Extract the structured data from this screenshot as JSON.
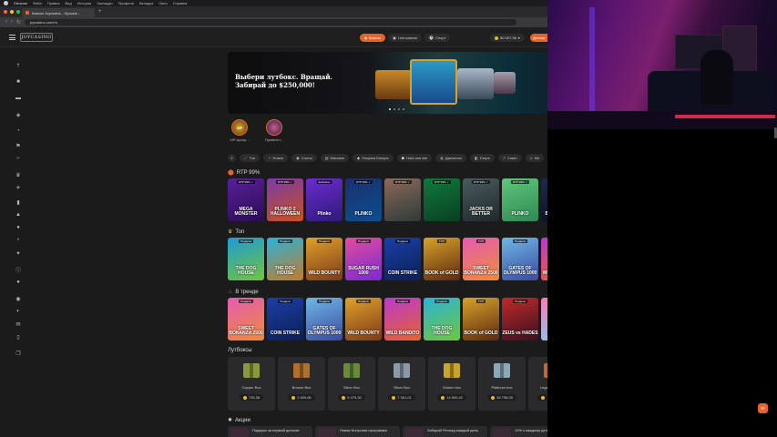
{
  "mac": {
    "app": "Chrome",
    "menus": [
      "Файл",
      "Правка",
      "Вид",
      "История",
      "Закладки",
      "Профили",
      "Вкладка",
      "Окно",
      "Справка"
    ]
  },
  "browser": {
    "tab_title": "Казино Joycasino - Лучшие...",
    "url": "joycasino.com/ru"
  },
  "header": {
    "logo": "JOYCASINO",
    "nav": [
      {
        "label": "Казино",
        "icon": "casino-icon",
        "active": true
      },
      {
        "label": "Live-казино",
        "icon": "live-icon",
        "active": false
      },
      {
        "label": "Спорт",
        "icon": "sport-icon",
        "active": false
      }
    ],
    "balance": "50 007,96",
    "deposit_label": "Депози"
  },
  "banner": {
    "text": "Выбери лутбокс. Вращай.\nЗабирай до $250,000!"
  },
  "stories": [
    {
      "badge": "VIP",
      "label": "VIP-прогр..."
    },
    {
      "badge": "",
      "label": "Приветст..."
    }
  ],
  "filters": [
    "Топ",
    "Новое",
    "Слоты",
    "Магазин",
    "Покупка Бонуса",
    "Hold and win",
    "Джекпоты",
    "Drops",
    "Crash",
    "Ме"
  ],
  "sections": {
    "rtp": "RTP 99%",
    "top": "Топ",
    "trending": "В тренде",
    "lootboxes": "Лутбоксы",
    "promotions": "Акции"
  },
  "rtp_games": [
    {
      "name": "MEGA MONSTER",
      "badge": "RTP 99% ✓",
      "color": "#5a1f9a",
      "color2": "#2a0d55"
    },
    {
      "name": "PLINKO 2 HALLOWEEN",
      "badge": "RTP 99% ✓",
      "color": "#7b3aa8",
      "color2": "#c8521e"
    },
    {
      "name": "Plinko",
      "badge": "Exclusive",
      "color": "#6b2ccf",
      "color2": "#2d1a7a"
    },
    {
      "name": "PLINKO",
      "badge": "RTP 99% ✓",
      "color": "#1a2f6e",
      "color2": "#0c4f8e"
    },
    {
      "name": "",
      "badge": "RTP 99% ✓",
      "color": "#8c6a58",
      "color2": "#2e3a3a"
    },
    {
      "name": "",
      "badge": "RTP 99% ✓",
      "color": "#0f7a3c",
      "color2": "#0a3f22"
    },
    {
      "name": "JACKS OR BETTER",
      "badge": "RTP 99% ✓",
      "color": "#4a5a5e",
      "color2": "#1f2a2d"
    },
    {
      "name": "PLINKO",
      "badge": "RTP 99% ✓",
      "color": "#5ec77a",
      "color2": "#2f8a55"
    },
    {
      "name": "BLACKJACK",
      "badge": "RTP 99% ✓",
      "color": "#1c2a4a",
      "color2": "#0a0f22"
    }
  ],
  "top_games": [
    {
      "name": "THE DOG HOUSE",
      "badge": "Подарок",
      "color": "#1f9ad6",
      "color2": "#6fc63b"
    },
    {
      "name": "THE DOG HOUSE",
      "badge": "Подарок",
      "color": "#2ab3d9",
      "color2": "#c37b2a"
    },
    {
      "name": "WILD BOUNTY",
      "badge": "Подарок",
      "color": "#e0a12a",
      "color2": "#7c3a1a"
    },
    {
      "name": "SUGAR RUSH 1000",
      "badge": "Подарок",
      "color": "#e24c9e",
      "color2": "#7a2ad0"
    },
    {
      "name": "COIN STRIKE",
      "badge": "Подарок",
      "color": "#1a3fa8",
      "color2": "#0c1f55"
    },
    {
      "name": "BOOK of GOLD",
      "badge": "ТОП",
      "color": "#d8a12a",
      "color2": "#5c2a10"
    },
    {
      "name": "SWEET BONANZA 2500",
      "badge": "ТОП",
      "color": "#e45cb0",
      "color2": "#f08a3a"
    },
    {
      "name": "GATES OF OLYMPUS 1000",
      "badge": "Подарок",
      "color": "#6fb8e6",
      "color2": "#3a4aa0"
    },
    {
      "name": "WILD BANDITO",
      "badge": "Подарок",
      "color": "#b93ad0",
      "color2": "#e8632c"
    }
  ],
  "trending_games": [
    {
      "name": "SWEET BONANZA 2500",
      "badge": "Подарок",
      "color": "#e45cb0",
      "color2": "#f08a3a"
    },
    {
      "name": "COIN STRIKE",
      "badge": "Подарок",
      "color": "#1a3fa8",
      "color2": "#0c1f55"
    },
    {
      "name": "GATES OF OLYMPUS 1000",
      "badge": "Подарок",
      "color": "#6fb8e6",
      "color2": "#3a4aa0"
    },
    {
      "name": "WILD BOUNTY",
      "badge": "Подарок",
      "color": "#e0a12a",
      "color2": "#7c3a1a"
    },
    {
      "name": "WILD BANDITO",
      "badge": "Подарок",
      "color": "#b93ad0",
      "color2": "#e8632c"
    },
    {
      "name": "THE DOG HOUSE",
      "badge": "Подарок",
      "color": "#2ab3d9",
      "color2": "#6fc63b"
    },
    {
      "name": "BOOK of GOLD",
      "badge": "ТОП",
      "color": "#d8a12a",
      "color2": "#5c2a10"
    },
    {
      "name": "ZEUS vs HADES",
      "badge": "Подарок",
      "color": "#c12a2a",
      "color2": "#3a1020"
    },
    {
      "name": "SWEET BONANZA",
      "badge": "Подарок",
      "color": "#ff7ab8",
      "color2": "#7ad0f0"
    }
  ],
  "lootboxes": [
    {
      "name": "Copper Box",
      "price": "735,38",
      "color": "#8a9a3a"
    },
    {
      "name": "Bronze Box",
      "price": "2 659,80",
      "color": "#b0702a"
    },
    {
      "name": "Silver Box",
      "price": "5 479,30",
      "color": "#6a8a3a"
    },
    {
      "name": "Silver Box",
      "price": "7 361,01",
      "color": "#8a9aa8"
    },
    {
      "name": "Golden box",
      "price": "14 600,42",
      "color": "#c9a42a"
    },
    {
      "name": "Platinum box",
      "price": "38 798,05",
      "color": "#8aa8b8"
    },
    {
      "name": "Legendary box",
      "price": "73 018,11",
      "color": "#c06a2a"
    }
  ],
  "promos": [
    "Подарок за первый депозит",
    "Новая Бонусная программа",
    "Забирай Релоад каждый день",
    "10% к каждому депозиту в"
  ]
}
